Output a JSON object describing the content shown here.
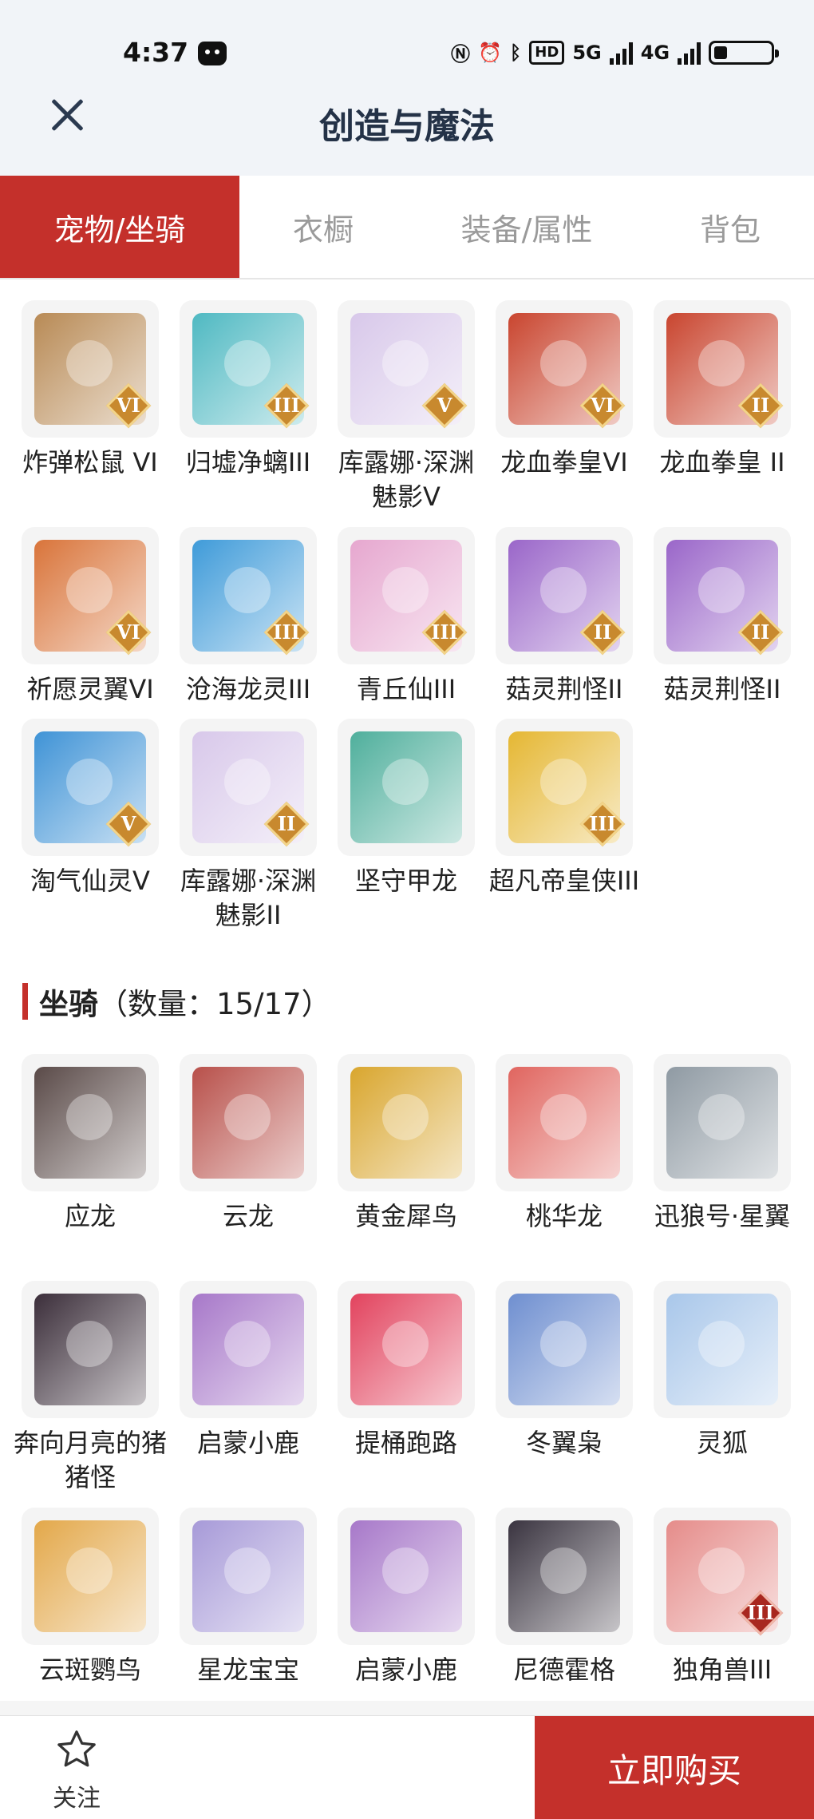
{
  "status_bar": {
    "time": "4:37",
    "hd_label": "HD",
    "net1": "5G",
    "net2": "4G"
  },
  "header": {
    "title": "创造与魔法"
  },
  "tabs": [
    {
      "label": "宠物/坐骑"
    },
    {
      "label": "衣橱"
    },
    {
      "label": "装备/属性"
    },
    {
      "label": "背包"
    }
  ],
  "pets": [
    {
      "name": "炸弹松鼠 VI",
      "badge": "VI",
      "color": "#b88a55"
    },
    {
      "name": "归墟净螭III",
      "badge": "III",
      "color": "#4fb9c2"
    },
    {
      "name": "库露娜·深渊魅影V",
      "badge": "V",
      "color": "#d8c8ea"
    },
    {
      "name": "龙血拳皇VI",
      "badge": "VI",
      "color": "#c9452f"
    },
    {
      "name": "龙血拳皇 II",
      "badge": "II",
      "color": "#c9452f"
    },
    {
      "name": "祈愿灵翼VI",
      "badge": "VI",
      "color": "#d9743a"
    },
    {
      "name": "沧海龙灵III",
      "badge": "III",
      "color": "#3f9bd9"
    },
    {
      "name": "青丘仙III",
      "badge": "III",
      "color": "#e6a7cf"
    },
    {
      "name": "菇灵荆怪II",
      "badge": "II",
      "color": "#9a66c9"
    },
    {
      "name": "菇灵荆怪II",
      "badge": "II",
      "color": "#9a66c9"
    },
    {
      "name": "淘气仙灵V",
      "badge": "V",
      "color": "#3f93d6"
    },
    {
      "name": "库露娜·深渊魅影II",
      "badge": "II",
      "color": "#d8c8ea"
    },
    {
      "name": "坚守甲龙",
      "badge": "",
      "color": "#4faf9c"
    },
    {
      "name": "超凡帝皇侠III",
      "badge": "III",
      "color": "#e5b733"
    }
  ],
  "mounts_section": {
    "title": "坐骑",
    "count": "（数量：15/17）"
  },
  "mounts": [
    {
      "name": "应龙",
      "badge": "",
      "color": "#5a4a48"
    },
    {
      "name": "云龙",
      "badge": "",
      "color": "#b8504a"
    },
    {
      "name": "黄金犀鸟",
      "badge": "",
      "color": "#d9a62e"
    },
    {
      "name": "桃华龙",
      "badge": "",
      "color": "#e0655f"
    },
    {
      "name": "迅狼号·星翼",
      "badge": "",
      "color": "#8f9aa3"
    },
    {
      "name": "奔向月亮的猪猪怪",
      "badge": "",
      "color": "#3b2e3a"
    },
    {
      "name": "启蒙小鹿",
      "badge": "",
      "color": "#a778c9"
    },
    {
      "name": "提桶跑路",
      "badge": "",
      "color": "#e2435e"
    },
    {
      "name": "冬翼枭",
      "badge": "",
      "color": "#6f8fd0"
    },
    {
      "name": "灵狐",
      "badge": "",
      "color": "#a9c7ea"
    },
    {
      "name": "云斑鹦鸟",
      "badge": "",
      "color": "#e3a84a"
    },
    {
      "name": "星龙宝宝",
      "badge": "",
      "color": "#a79ad8"
    },
    {
      "name": "启蒙小鹿",
      "badge": "",
      "color": "#a778c9"
    },
    {
      "name": "尼德霍格",
      "badge": "",
      "color": "#3a3440"
    },
    {
      "name": "独角兽III",
      "badge": "III",
      "color": "#e58c8a"
    }
  ],
  "bottom_bar": {
    "favorite_label": "关注",
    "buy_label": "立即购买"
  },
  "colors": {
    "accent": "#c4302b",
    "badge_gold": "#c8892e",
    "badge_red": "#a8281f"
  }
}
